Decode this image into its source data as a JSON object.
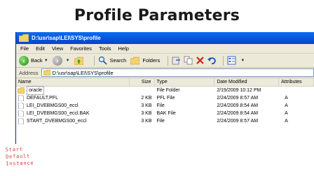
{
  "slide": {
    "title": "Profile Parameters"
  },
  "window": {
    "title": "D:\\usr\\sap\\LEI\\SYS\\profile",
    "menu": [
      "File",
      "Edit",
      "View",
      "Favorites",
      "Tools",
      "Help"
    ],
    "toolbar": {
      "back_label": "Back",
      "search_label": "Search",
      "folders_label": "Folders"
    },
    "address": {
      "label": "Address",
      "value": "D:\\usr\\sap\\LEI\\SYS\\profile"
    },
    "columns": {
      "name": "Name",
      "size": "Size",
      "type": "Type",
      "date": "Date Modified",
      "attributes": "Attributes"
    },
    "files": [
      {
        "name": "oracle",
        "size": "",
        "type": "File Folder",
        "date": "2/19/2009 10:12 PM",
        "attr": "",
        "icon": "folder-icon"
      },
      {
        "name": "DEFAULT.PFL",
        "size": "2 KB",
        "type": "PFL File",
        "date": "2/24/2009 8:57 AM",
        "attr": "A",
        "icon": "file-icon"
      },
      {
        "name": "LEI_DVEBMGS00_eccl",
        "size": "3 KB",
        "type": "File",
        "date": "2/24/2009 8:54 AM",
        "attr": "A",
        "icon": "file-icon"
      },
      {
        "name": "LEI_DVEBMGS00_eccl.BAK",
        "size": "3 KB",
        "type": "BAK File",
        "date": "2/24/2009 8:54 AM",
        "attr": "A",
        "icon": "file-icon"
      },
      {
        "name": "START_DVEBMGS00_eccl",
        "size": "3 KB",
        "type": "File",
        "date": "2/24/2009 8:57 AM",
        "attr": "A",
        "icon": "file-icon"
      }
    ]
  },
  "annotation": {
    "lines": [
      "Start",
      "Default",
      "Instance"
    ],
    "color": "#d23a2a"
  }
}
